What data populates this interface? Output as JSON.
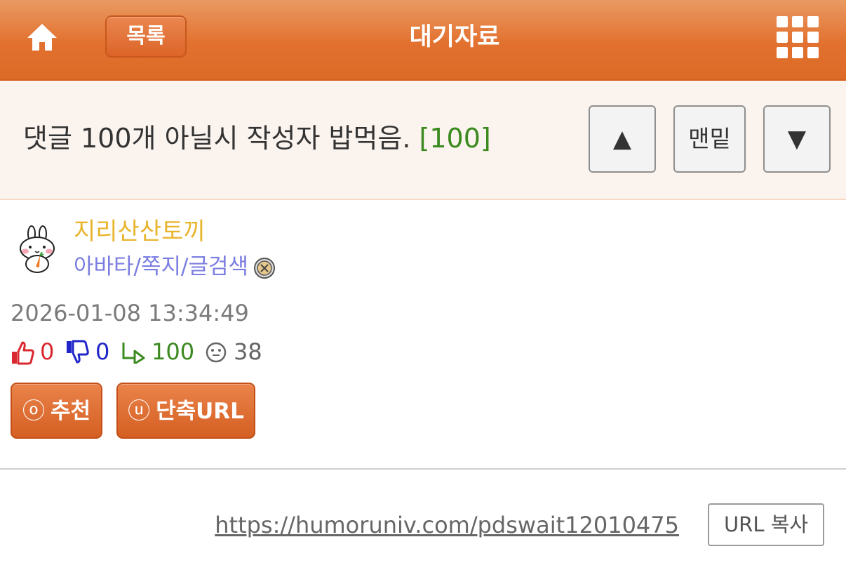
{
  "header": {
    "list_label": "목록",
    "title": "대기자료",
    "home_icon": "home-icon",
    "menu_icon": "grid-menu-icon",
    "colors": {
      "bar": "#e2712f",
      "text": "#ffffff"
    }
  },
  "post": {
    "title": "댓글 100개 아닐시 작성자 밥먹음.",
    "comment_count": "[100]",
    "nav": {
      "up": "▲",
      "bottom": "맨밑",
      "down": "▼"
    }
  },
  "author": {
    "name": "지리산산토끼",
    "links": "아바타/쪽지/글검색",
    "avatar_icon": "rabbit-avatar",
    "report_icon": "report-icon",
    "date": "2026-01-08 13:34:49"
  },
  "stats": {
    "upvotes": "0",
    "downvotes": "0",
    "replies": "100",
    "views": "38",
    "colors": {
      "up": "#d9282f",
      "down": "#1f25c9",
      "reply": "#3b8a1f",
      "views": "#666666"
    }
  },
  "actions": {
    "recommend_icon": "ⓞ",
    "recommend": "추천",
    "shorturl_icon": "ⓤ",
    "shorturl": "단축URL"
  },
  "url": {
    "link": "https://humoruniv.com/pdswait12010475",
    "copy_label": "URL 복사"
  }
}
